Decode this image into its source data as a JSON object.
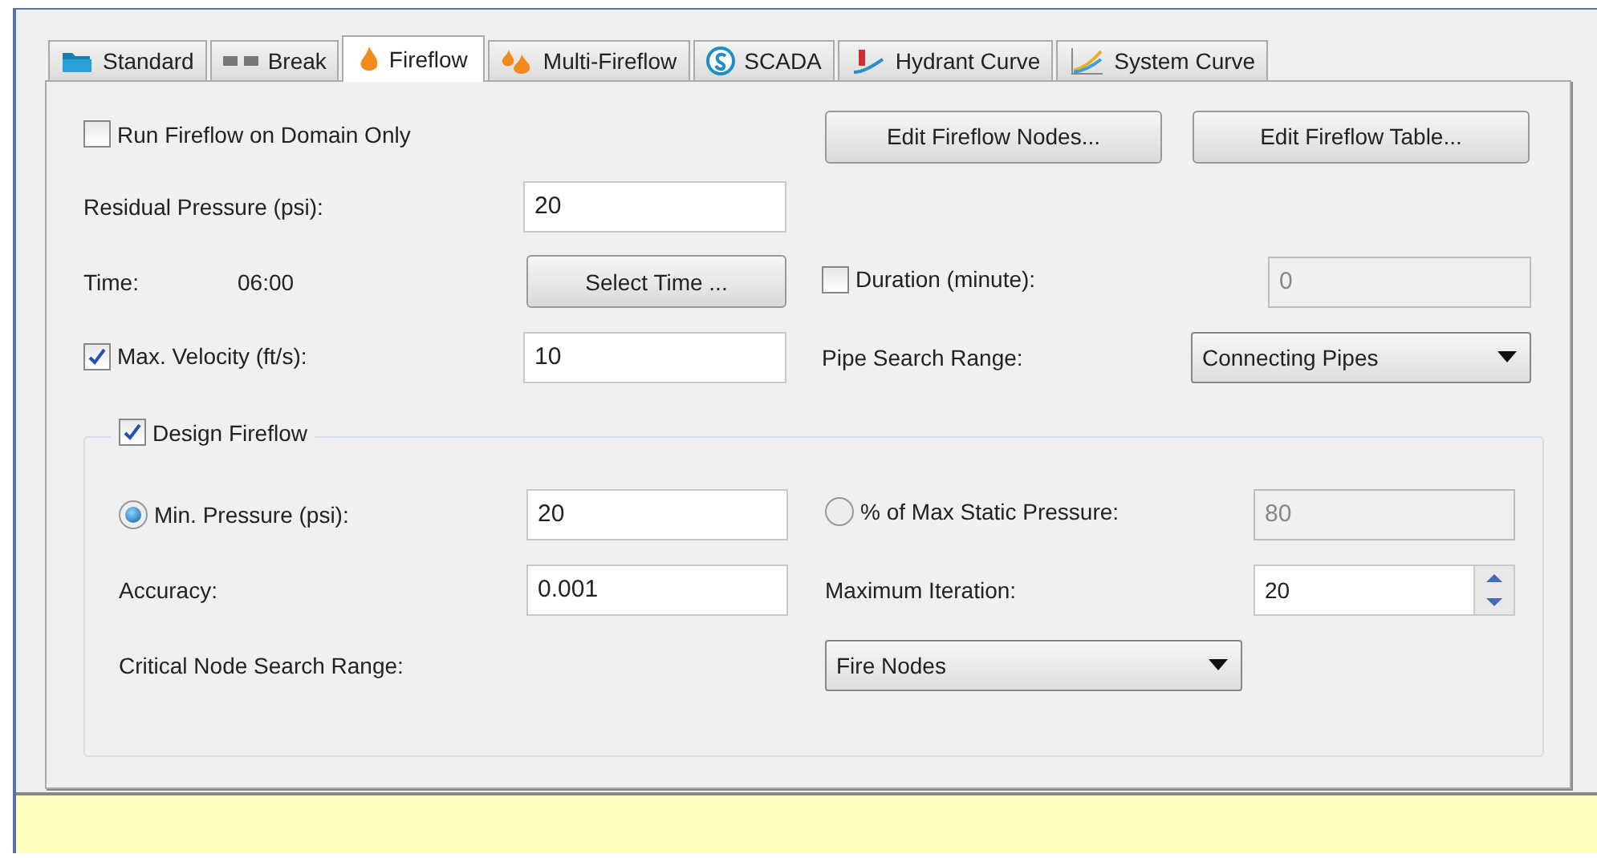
{
  "tabs": [
    {
      "label": "Standard",
      "selected": false
    },
    {
      "label": "Break",
      "selected": false
    },
    {
      "label": "Fireflow",
      "selected": true
    },
    {
      "label": "Multi-Fireflow",
      "selected": false
    },
    {
      "label": "SCADA",
      "selected": false
    },
    {
      "label": "Hydrant Curve",
      "selected": false
    },
    {
      "label": "System Curve",
      "selected": false
    }
  ],
  "domain_only": {
    "label": "Run Fireflow on Domain Only",
    "checked": false
  },
  "buttons": [
    "Edit Fireflow Nodes...",
    "Edit Fireflow Table..."
  ],
  "residual_pressure": {
    "label": "Residual Pressure (psi):",
    "value": "20"
  },
  "time": {
    "label": "Time:",
    "value": "06:00",
    "button": "Select Time ..."
  },
  "duration": {
    "label": "Duration (minute):",
    "checked": false,
    "value": "0",
    "disabled": true
  },
  "max_velocity": {
    "label": "Max. Velocity (ft/s):",
    "checked": true,
    "value": "10"
  },
  "pipe_search_range": {
    "label": "Pipe Search Range:",
    "value": "Connecting Pipes"
  },
  "design_fireflow": {
    "label": "Design Fireflow",
    "checked": true,
    "min_pressure": {
      "label": "Min. Pressure (psi):",
      "selected": true,
      "value": "20",
      "disabled": false
    },
    "max_static": {
      "label": "% of Max Static Pressure:",
      "selected": false,
      "value": "80",
      "disabled": true
    },
    "accuracy": {
      "label": "Accuracy:",
      "value": "0.001"
    },
    "max_iteration": {
      "label": "Maximum Iteration:",
      "value": "20"
    },
    "critical_node": {
      "label": "Critical Node Search Range:",
      "value": "Fire Nodes"
    }
  }
}
